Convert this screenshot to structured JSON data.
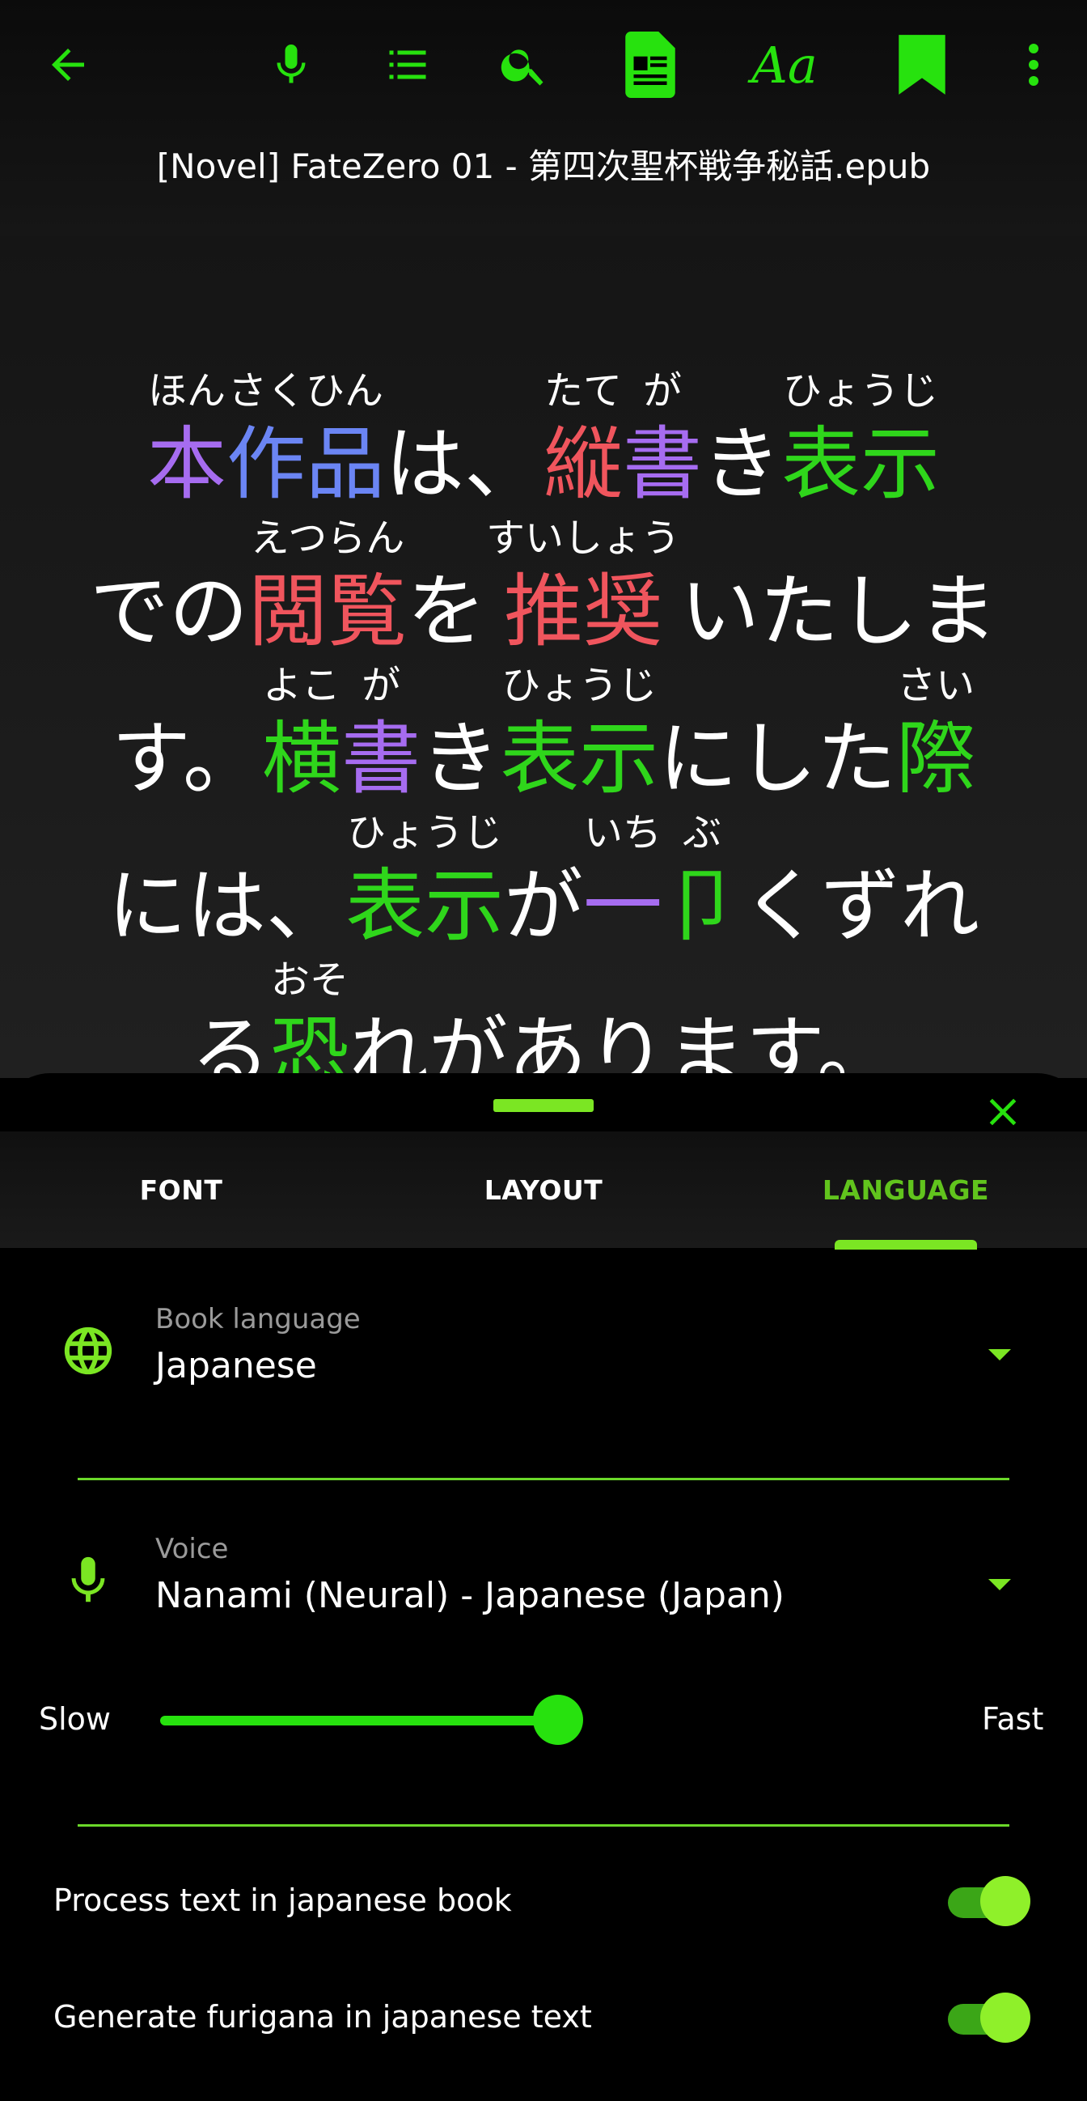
{
  "colors": {
    "accent": "#27e20e",
    "accent_light": "#7be623",
    "background": "#000000"
  },
  "toolbar": {
    "icons": [
      "back-arrow-icon",
      "microphone-icon",
      "list-icon",
      "search-icon",
      "document-icon",
      "font-aa-icon",
      "bookmark-icon",
      "more-vert-icon"
    ],
    "font_icon_text": "Aa",
    "book_title": "[Novel] FateZero 01 - 第四次聖杯戦争秘話.epub"
  },
  "reader": {
    "lines": [
      [
        {
          "t": "本",
          "r": "ほん",
          "c": "#a66cf0"
        },
        {
          "t": "作品",
          "r": "さくひん",
          "c": "#6b85f4"
        },
        {
          "t": "は、",
          "r": "",
          "c": "#ffffff"
        },
        {
          "t": "縦",
          "r": "たて",
          "c": "#f0555d"
        },
        {
          "t": "書",
          "r": "が",
          "c": "#a66cf0"
        },
        {
          "t": "き",
          "r": "",
          "c": "#ffffff"
        },
        {
          "t": "表示",
          "r": "ひょうじ",
          "c": "#2fd61b"
        }
      ],
      [
        {
          "t": "での",
          "r": "",
          "c": "#ffffff"
        },
        {
          "t": "閲覧",
          "r": "えつらん",
          "c": "#f0555d"
        },
        {
          "t": "を ",
          "r": "",
          "c": "#ffffff"
        },
        {
          "t": "推奨",
          "r": "すいしょう",
          "c": "#f0555d"
        },
        {
          "t": " いたしま",
          "r": "",
          "c": "#ffffff"
        }
      ],
      [
        {
          "t": "す。",
          "r": "",
          "c": "#ffffff"
        },
        {
          "t": "横",
          "r": "よこ",
          "c": "#2fd61b"
        },
        {
          "t": "書",
          "r": "が",
          "c": "#a66cf0"
        },
        {
          "t": "き",
          "r": "",
          "c": "#ffffff"
        },
        {
          "t": "表示",
          "r": "ひょうじ",
          "c": "#2fd61b"
        },
        {
          "t": "にした",
          "r": "",
          "c": "#ffffff"
        },
        {
          "t": "際",
          "r": "さい",
          "c": "#2fd61b"
        }
      ],
      [
        {
          "t": "には、",
          "r": "",
          "c": "#ffffff"
        },
        {
          "t": "表示",
          "r": "ひょうじ",
          "c": "#2fd61b"
        },
        {
          "t": "が",
          "r": "",
          "c": "#ffffff"
        },
        {
          "t": "一",
          "r": "いち",
          "c": "#a66cf0"
        },
        {
          "t": "卩",
          "r": "ぶ",
          "c": "#2fd61b"
        },
        {
          "t": "くずれ",
          "r": "",
          "c": "#ffffff"
        }
      ],
      [
        {
          "t": "る",
          "r": "",
          "c": "#ffffff"
        },
        {
          "t": "恐",
          "r": "おそ",
          "c": "#2fd61b"
        },
        {
          "t": "れがあります。",
          "r": "",
          "c": "#ffffff"
        }
      ]
    ]
  },
  "sheet": {
    "tabs": [
      {
        "label": "FONT",
        "active": false
      },
      {
        "label": "LAYOUT",
        "active": false
      },
      {
        "label": "LANGUAGE",
        "active": true
      }
    ],
    "book_language": {
      "label": "Book language",
      "value": "Japanese",
      "icon": "globe-icon"
    },
    "voice": {
      "label": "Voice",
      "value": "Nanami (Neural) - Japanese (Japan)",
      "icon": "microphone-icon"
    },
    "speed": {
      "min_label": "Slow",
      "max_label": "Fast",
      "value": 0.58
    },
    "toggles": [
      {
        "label": "Process text in japanese book",
        "on": true
      },
      {
        "label": "Generate furigana in japanese text",
        "on": true
      }
    ]
  }
}
